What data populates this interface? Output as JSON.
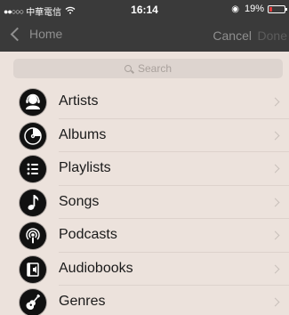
{
  "status_bar": {
    "carrier": "中華電信",
    "time": "16:14",
    "battery_percent": "19%",
    "battery_level": 0.19
  },
  "nav": {
    "back_label": "Home",
    "cancel_label": "Cancel",
    "done_label": "Done"
  },
  "search": {
    "placeholder": "Search"
  },
  "list": {
    "items": [
      {
        "label": "Artists",
        "icon": "artists-icon"
      },
      {
        "label": "Albums",
        "icon": "albums-icon"
      },
      {
        "label": "Playlists",
        "icon": "playlists-icon"
      },
      {
        "label": "Songs",
        "icon": "songs-icon"
      },
      {
        "label": "Podcasts",
        "icon": "podcasts-icon"
      },
      {
        "label": "Audiobooks",
        "icon": "audiobooks-icon"
      },
      {
        "label": "Genres",
        "icon": "genres-icon"
      }
    ]
  },
  "colors": {
    "background": "#ece2dc",
    "bar": "#3a3a3a",
    "battery_low": "#e23b3b"
  }
}
